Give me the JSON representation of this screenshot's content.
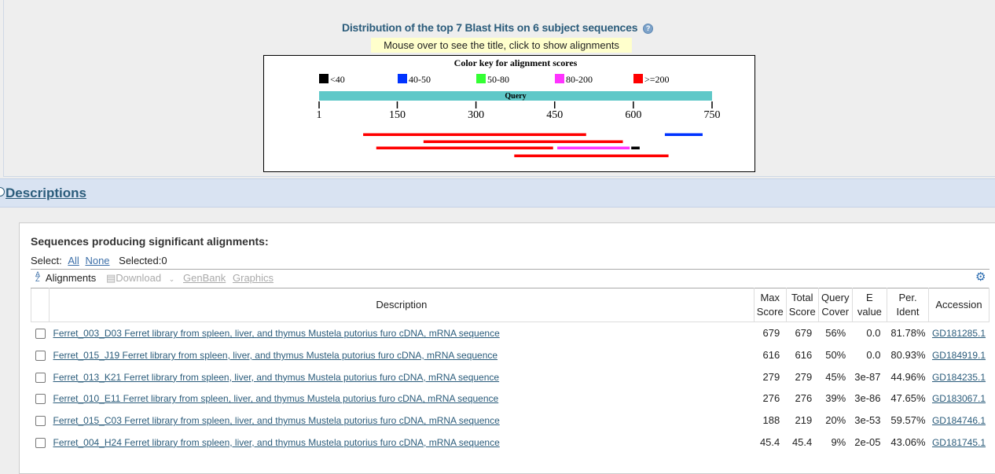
{
  "graphic": {
    "title": "Distribution of the top 7 Blast Hits on 6 subject sequences",
    "help_glyph": "?",
    "mouseover_note": "Mouse over to see the title, click to show alignments",
    "color_key_title": "Color key for alignment scores",
    "color_key": [
      {
        "label": "<40",
        "color": "#000000"
      },
      {
        "label": "40-50",
        "color": "#0033ff"
      },
      {
        "label": "50-80",
        "color": "#33ff33"
      },
      {
        "label": "80-200",
        "color": "#ff33ff"
      },
      {
        "label": ">=200",
        "color": "#ff0000"
      }
    ],
    "query_label": "Query",
    "query_bar_color": "#5fc8c8",
    "axis": {
      "min": 1,
      "max": 750,
      "ticks": [
        1,
        150,
        300,
        450,
        600,
        750
      ]
    },
    "hits": [
      {
        "row": 0,
        "start": 85,
        "end": 510,
        "color": "#ff0000"
      },
      {
        "row": 0,
        "start": 660,
        "end": 732,
        "color": "#0033ff"
      },
      {
        "row": 1,
        "start": 200,
        "end": 580,
        "color": "#ff0000"
      },
      {
        "row": 2,
        "start": 110,
        "end": 447,
        "color": "#ff0000"
      },
      {
        "row": 2,
        "start": 455,
        "end": 593,
        "color": "#ff33ff"
      },
      {
        "row": 2,
        "start": 596,
        "end": 612,
        "color": "#000000"
      },
      {
        "row": 3,
        "start": 373,
        "end": 667,
        "color": "#ff0000"
      }
    ]
  },
  "descriptions_header": "Descriptions",
  "results": {
    "heading": "Sequences producing significant alignments:",
    "select_label": "Select:",
    "select_all": "All",
    "select_none": "None",
    "selected_count": "Selected:0",
    "toolbar": {
      "alignments": "Alignments",
      "download": "Download",
      "genbank": "GenBank",
      "graphics": "Graphics"
    },
    "columns": {
      "description": "Description",
      "max_score": [
        "Max",
        "Score"
      ],
      "total_score": [
        "Total",
        "Score"
      ],
      "query_cover": [
        "Query",
        "Cover"
      ],
      "e_value": [
        "E",
        "value"
      ],
      "per_ident": [
        "Per.",
        "Ident"
      ],
      "accession": "Accession"
    },
    "rows": [
      {
        "description": "Ferret_003_D03 Ferret library from spleen, liver, and thymus Mustela putorius furo cDNA, mRNA sequence",
        "max_score": "679",
        "total_score": "679",
        "query_cover": "56%",
        "e_value": "0.0",
        "per_ident": "81.78%",
        "accession": "GD181285.1"
      },
      {
        "description": "Ferret_015_J19 Ferret library from spleen, liver, and thymus Mustela putorius furo cDNA, mRNA sequence",
        "max_score": "616",
        "total_score": "616",
        "query_cover": "50%",
        "e_value": "0.0",
        "per_ident": "80.93%",
        "accession": "GD184919.1"
      },
      {
        "description": "Ferret_013_K21 Ferret library from spleen, liver, and thymus Mustela putorius furo cDNA, mRNA sequence",
        "max_score": "279",
        "total_score": "279",
        "query_cover": "45%",
        "e_value": "3e-87",
        "per_ident": "44.96%",
        "accession": "GD184235.1"
      },
      {
        "description": "Ferret_010_E11 Ferret library from spleen, liver, and thymus Mustela putorius furo cDNA, mRNA sequence",
        "max_score": "276",
        "total_score": "276",
        "query_cover": "39%",
        "e_value": "3e-86",
        "per_ident": "47.65%",
        "accession": "GD183067.1"
      },
      {
        "description": "Ferret_015_C03 Ferret library from spleen, liver, and thymus Mustela putorius furo cDNA, mRNA sequence",
        "max_score": "188",
        "total_score": "219",
        "query_cover": "20%",
        "e_value": "3e-53",
        "per_ident": "59.57%",
        "accession": "GD184746.1"
      },
      {
        "description": "Ferret_004_H24 Ferret library from spleen, liver, and thymus Mustela putorius furo cDNA, mRNA sequence",
        "max_score": "45.4",
        "total_score": "45.4",
        "query_cover": "9%",
        "e_value": "2e-05",
        "per_ident": "43.06%",
        "accession": "GD181745.1"
      }
    ]
  }
}
